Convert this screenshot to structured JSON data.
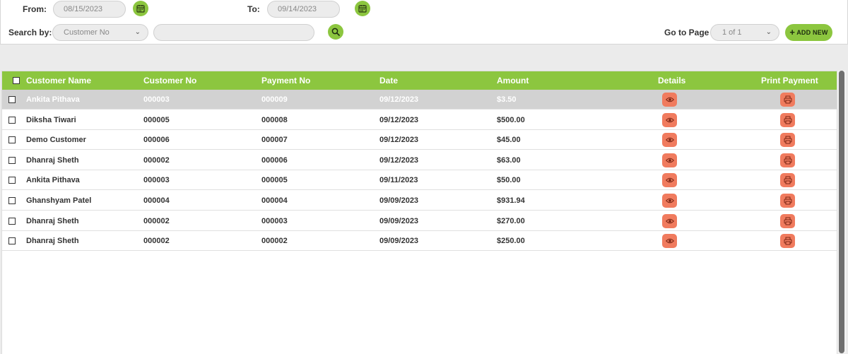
{
  "filters": {
    "from_label": "From:",
    "from_value": "08/15/2023",
    "to_label": "To:",
    "to_value": "09/14/2023",
    "search_label": "Search by:",
    "search_by_value": "Customer No",
    "search_query": "",
    "goto_label": "Go to Page",
    "page_value": "1 of 1",
    "add_new_label": "ADD NEW"
  },
  "table": {
    "headers": {
      "customer_name": "Customer Name",
      "customer_no": "Customer No",
      "payment_no": "Payment No",
      "date": "Date",
      "amount": "Amount",
      "details": "Details",
      "print_payment": "Print Payment"
    },
    "rows": [
      {
        "customer_name": "Ankita Pithava",
        "customer_no": "000003",
        "payment_no": "000009",
        "date": "09/12/2023",
        "amount": "$3.50"
      },
      {
        "customer_name": "Diksha Tiwari",
        "customer_no": "000005",
        "payment_no": "000008",
        "date": "09/12/2023",
        "amount": "$500.00"
      },
      {
        "customer_name": "Demo Customer",
        "customer_no": "000006",
        "payment_no": "000007",
        "date": "09/12/2023",
        "amount": "$45.00"
      },
      {
        "customer_name": "Dhanraj Sheth",
        "customer_no": "000002",
        "payment_no": "000006",
        "date": "09/12/2023",
        "amount": "$63.00"
      },
      {
        "customer_name": "Ankita Pithava",
        "customer_no": "000003",
        "payment_no": "000005",
        "date": "09/11/2023",
        "amount": "$50.00"
      },
      {
        "customer_name": "Ghanshyam Patel",
        "customer_no": "000004",
        "payment_no": "000004",
        "date": "09/09/2023",
        "amount": "$931.94"
      },
      {
        "customer_name": "Dhanraj Sheth",
        "customer_no": "000002",
        "payment_no": "000003",
        "date": "09/09/2023",
        "amount": "$270.00"
      },
      {
        "customer_name": "Dhanraj Sheth",
        "customer_no": "000002",
        "payment_no": "000002",
        "date": "09/09/2023",
        "amount": "$250.00"
      }
    ]
  },
  "colors": {
    "accent_green": "#8cc63f",
    "action_salmon": "#f07b5e",
    "selected_row": "#d2d2d2"
  },
  "icons": {
    "calendar": "calendar-icon",
    "search": "search-icon",
    "details": "eye-icon",
    "print": "printer-icon",
    "dropdown": "chevron-down-icon",
    "add": "plus-icon"
  }
}
